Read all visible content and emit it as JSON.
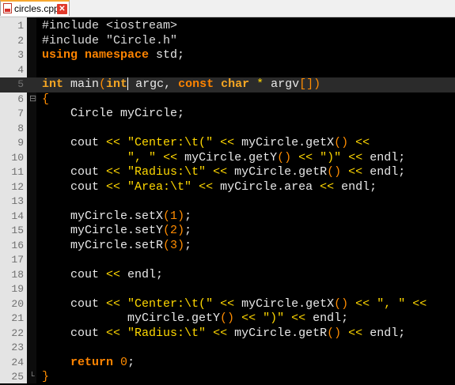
{
  "tab": {
    "filename": "circles.cpp",
    "close_glyph": "✕",
    "icon": "cpp-file-icon"
  },
  "colors": {
    "background": "#000000",
    "keyword": "#ff8400",
    "string": "#ffd800",
    "operator": "#ffd700",
    "number": "#ff8c00",
    "identifier": "#e8e8e8",
    "gutter": "#e4e4e4",
    "tab_accent": "#f7a830"
  },
  "editor": {
    "current_line": 5,
    "lines": [
      {
        "n": "1",
        "fold": "",
        "tokens": [
          {
            "t": "#include <iostream>",
            "c": "pp"
          }
        ]
      },
      {
        "n": "2",
        "fold": "",
        "tokens": [
          {
            "t": "#include \"Circle.h\"",
            "c": "pp"
          }
        ]
      },
      {
        "n": "3",
        "fold": "",
        "tokens": [
          {
            "t": "using",
            "c": "kw"
          },
          {
            "t": " ",
            "c": "id"
          },
          {
            "t": "namespace",
            "c": "kw"
          },
          {
            "t": " std;",
            "c": "id"
          }
        ]
      },
      {
        "n": "4",
        "fold": "",
        "tokens": []
      },
      {
        "n": "5",
        "fold": "",
        "tokens": [
          {
            "t": "int",
            "c": "ty"
          },
          {
            "t": " main",
            "c": "id"
          },
          {
            "t": "(",
            "c": "br"
          },
          {
            "t": "int",
            "c": "ty"
          },
          {
            "t": "|caret|",
            "c": "caret"
          },
          {
            "t": " argc, ",
            "c": "id"
          },
          {
            "t": "const",
            "c": "kw"
          },
          {
            "t": " ",
            "c": "id"
          },
          {
            "t": "char",
            "c": "ty"
          },
          {
            "t": " ",
            "c": "id"
          },
          {
            "t": "*",
            "c": "op"
          },
          {
            "t": " argv",
            "c": "id"
          },
          {
            "t": "[])",
            "c": "br"
          }
        ]
      },
      {
        "n": "6",
        "fold": "⊟",
        "tokens": [
          {
            "t": "{",
            "c": "br"
          }
        ]
      },
      {
        "n": "7",
        "fold": "",
        "tokens": [
          {
            "t": "    Circle myCircle;",
            "c": "id"
          }
        ]
      },
      {
        "n": "8",
        "fold": "",
        "tokens": []
      },
      {
        "n": "9",
        "fold": "",
        "tokens": [
          {
            "t": "    cout ",
            "c": "id"
          },
          {
            "t": "<<",
            "c": "op"
          },
          {
            "t": " ",
            "c": "id"
          },
          {
            "t": "\"Center:\\t(\"",
            "c": "str"
          },
          {
            "t": " ",
            "c": "id"
          },
          {
            "t": "<<",
            "c": "op"
          },
          {
            "t": " myCircle.getX",
            "c": "id"
          },
          {
            "t": "()",
            "c": "br"
          },
          {
            "t": " ",
            "c": "id"
          },
          {
            "t": "<<",
            "c": "op"
          }
        ]
      },
      {
        "n": "10",
        "fold": "",
        "tokens": [
          {
            "t": "            ",
            "c": "id"
          },
          {
            "t": "\", \"",
            "c": "str"
          },
          {
            "t": " ",
            "c": "id"
          },
          {
            "t": "<<",
            "c": "op"
          },
          {
            "t": " myCircle.getY",
            "c": "id"
          },
          {
            "t": "()",
            "c": "br"
          },
          {
            "t": " ",
            "c": "id"
          },
          {
            "t": "<<",
            "c": "op"
          },
          {
            "t": " ",
            "c": "id"
          },
          {
            "t": "\")\"",
            "c": "str"
          },
          {
            "t": " ",
            "c": "id"
          },
          {
            "t": "<<",
            "c": "op"
          },
          {
            "t": " endl;",
            "c": "id"
          }
        ]
      },
      {
        "n": "11",
        "fold": "",
        "tokens": [
          {
            "t": "    cout ",
            "c": "id"
          },
          {
            "t": "<<",
            "c": "op"
          },
          {
            "t": " ",
            "c": "id"
          },
          {
            "t": "\"Radius:\\t\"",
            "c": "str"
          },
          {
            "t": " ",
            "c": "id"
          },
          {
            "t": "<<",
            "c": "op"
          },
          {
            "t": " myCircle.getR",
            "c": "id"
          },
          {
            "t": "()",
            "c": "br"
          },
          {
            "t": " ",
            "c": "id"
          },
          {
            "t": "<<",
            "c": "op"
          },
          {
            "t": " endl;",
            "c": "id"
          }
        ]
      },
      {
        "n": "12",
        "fold": "",
        "tokens": [
          {
            "t": "    cout ",
            "c": "id"
          },
          {
            "t": "<<",
            "c": "op"
          },
          {
            "t": " ",
            "c": "id"
          },
          {
            "t": "\"Area:\\t\"",
            "c": "str"
          },
          {
            "t": " ",
            "c": "id"
          },
          {
            "t": "<<",
            "c": "op"
          },
          {
            "t": " myCircle.area ",
            "c": "id"
          },
          {
            "t": "<<",
            "c": "op"
          },
          {
            "t": " endl;",
            "c": "id"
          }
        ]
      },
      {
        "n": "13",
        "fold": "",
        "tokens": []
      },
      {
        "n": "14",
        "fold": "",
        "tokens": [
          {
            "t": "    myCircle.setX",
            "c": "id"
          },
          {
            "t": "(",
            "c": "br"
          },
          {
            "t": "1",
            "c": "num"
          },
          {
            "t": ")",
            "c": "br"
          },
          {
            "t": ";",
            "c": "id"
          }
        ]
      },
      {
        "n": "15",
        "fold": "",
        "tokens": [
          {
            "t": "    myCircle.setY",
            "c": "id"
          },
          {
            "t": "(",
            "c": "br"
          },
          {
            "t": "2",
            "c": "num"
          },
          {
            "t": ")",
            "c": "br"
          },
          {
            "t": ";",
            "c": "id"
          }
        ]
      },
      {
        "n": "16",
        "fold": "",
        "tokens": [
          {
            "t": "    myCircle.setR",
            "c": "id"
          },
          {
            "t": "(",
            "c": "br"
          },
          {
            "t": "3",
            "c": "num"
          },
          {
            "t": ")",
            "c": "br"
          },
          {
            "t": ";",
            "c": "id"
          }
        ]
      },
      {
        "n": "17",
        "fold": "",
        "tokens": []
      },
      {
        "n": "18",
        "fold": "",
        "tokens": [
          {
            "t": "    cout ",
            "c": "id"
          },
          {
            "t": "<<",
            "c": "op"
          },
          {
            "t": " endl;",
            "c": "id"
          }
        ]
      },
      {
        "n": "19",
        "fold": "",
        "tokens": []
      },
      {
        "n": "20",
        "fold": "",
        "tokens": [
          {
            "t": "    cout ",
            "c": "id"
          },
          {
            "t": "<<",
            "c": "op"
          },
          {
            "t": " ",
            "c": "id"
          },
          {
            "t": "\"Center:\\t(\"",
            "c": "str"
          },
          {
            "t": " ",
            "c": "id"
          },
          {
            "t": "<<",
            "c": "op"
          },
          {
            "t": " myCircle.getX",
            "c": "id"
          },
          {
            "t": "()",
            "c": "br"
          },
          {
            "t": " ",
            "c": "id"
          },
          {
            "t": "<<",
            "c": "op"
          },
          {
            "t": " ",
            "c": "id"
          },
          {
            "t": "\", \"",
            "c": "str"
          },
          {
            "t": " ",
            "c": "id"
          },
          {
            "t": "<<",
            "c": "op"
          }
        ]
      },
      {
        "n": "21",
        "fold": "",
        "tokens": [
          {
            "t": "            myCircle.getY",
            "c": "id"
          },
          {
            "t": "()",
            "c": "br"
          },
          {
            "t": " ",
            "c": "id"
          },
          {
            "t": "<<",
            "c": "op"
          },
          {
            "t": " ",
            "c": "id"
          },
          {
            "t": "\")\"",
            "c": "str"
          },
          {
            "t": " ",
            "c": "id"
          },
          {
            "t": "<<",
            "c": "op"
          },
          {
            "t": " endl;",
            "c": "id"
          }
        ]
      },
      {
        "n": "22",
        "fold": "",
        "tokens": [
          {
            "t": "    cout ",
            "c": "id"
          },
          {
            "t": "<<",
            "c": "op"
          },
          {
            "t": " ",
            "c": "id"
          },
          {
            "t": "\"Radius:\\t\"",
            "c": "str"
          },
          {
            "t": " ",
            "c": "id"
          },
          {
            "t": "<<",
            "c": "op"
          },
          {
            "t": " myCircle.getR",
            "c": "id"
          },
          {
            "t": "()",
            "c": "br"
          },
          {
            "t": " ",
            "c": "id"
          },
          {
            "t": "<<",
            "c": "op"
          },
          {
            "t": " endl;",
            "c": "id"
          }
        ]
      },
      {
        "n": "23",
        "fold": "",
        "tokens": []
      },
      {
        "n": "24",
        "fold": "",
        "tokens": [
          {
            "t": "    ",
            "c": "id"
          },
          {
            "t": "return",
            "c": "kw"
          },
          {
            "t": " ",
            "c": "id"
          },
          {
            "t": "0",
            "c": "num"
          },
          {
            "t": ";",
            "c": "id"
          }
        ]
      },
      {
        "n": "25",
        "fold": "└",
        "tokens": [
          {
            "t": "}",
            "c": "br"
          }
        ]
      }
    ]
  }
}
